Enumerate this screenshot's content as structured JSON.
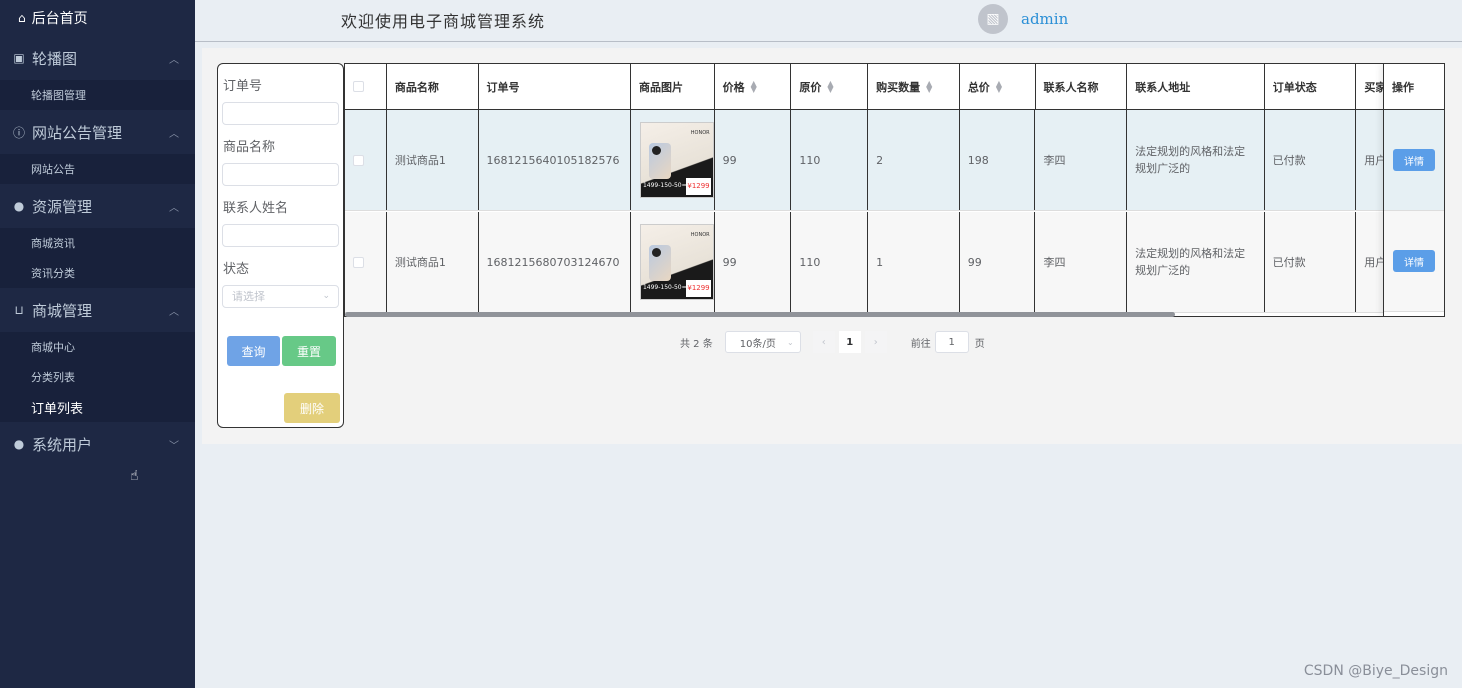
{
  "sidebar": {
    "home": "后台首页",
    "groups": [
      {
        "label": "轮播图",
        "items": [
          "轮播图管理"
        ]
      },
      {
        "label": "网站公告管理",
        "items": [
          "网站公告"
        ]
      },
      {
        "label": "资源管理",
        "items": [
          "商城资讯",
          "资讯分类"
        ]
      },
      {
        "label": "商城管理",
        "items": [
          "商城中心",
          "分类列表",
          "订单列表"
        ]
      },
      {
        "label": "系统用户",
        "items": []
      }
    ]
  },
  "header": {
    "title": "欢迎使用电子商城管理系统",
    "user": "admin"
  },
  "filter": {
    "order_no_label": "订单号",
    "product_name_label": "商品名称",
    "contact_name_label": "联系人姓名",
    "status_label": "状态",
    "status_placeholder": "请选择",
    "query_button": "查询",
    "reset_button": "重置",
    "delete_button": "删除"
  },
  "table": {
    "columns": {
      "product_name": "商品名称",
      "order_no": "订单号",
      "image": "商品图片",
      "price": "价格",
      "orig_price": "原价",
      "qty": "购买数量",
      "total": "总价",
      "contact": "联系人名称",
      "address": "联系人地址",
      "status": "订单状态",
      "buyer": "买家",
      "ops": "操作"
    },
    "rows": [
      {
        "product_name": "测试商品1",
        "order_no": "1681215640105182576",
        "price": "99",
        "orig_price": "110",
        "qty": "2",
        "total": "198",
        "contact": "李四",
        "address": "法定规划的风格和法定规划广泛的",
        "status": "已付款",
        "buyer": "用户",
        "detail": "详情"
      },
      {
        "product_name": "测试商品1",
        "order_no": "1681215680703124670",
        "price": "99",
        "orig_price": "110",
        "qty": "1",
        "total": "99",
        "contact": "李四",
        "address": "法定规划的风格和法定规划广泛的",
        "status": "已付款",
        "buyer": "用户",
        "detail": "详情"
      }
    ],
    "thumb": {
      "brand": "HONOR",
      "price": "¥1299",
      "band": "1499-150-50="
    }
  },
  "pagination": {
    "total": "共 2 条",
    "page_size": "10条/页",
    "prev": "‹",
    "current": "1",
    "next": "›",
    "goto_label": "前往",
    "goto_value": "1",
    "page_unit": "页"
  },
  "watermark": "CSDN @Biye_Design"
}
